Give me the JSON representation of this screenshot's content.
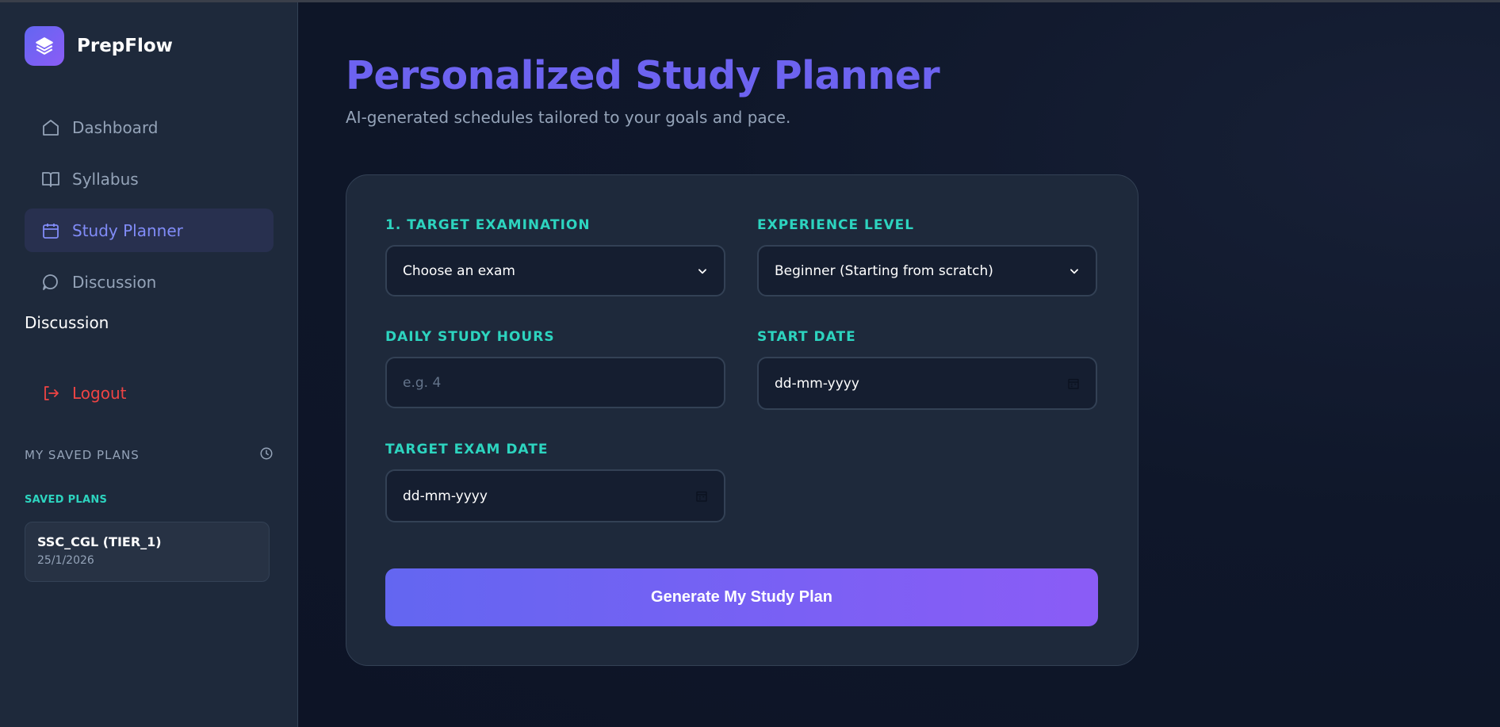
{
  "app": {
    "name": "PrepFlow"
  },
  "sidebar": {
    "items": [
      {
        "label": "Dashboard",
        "icon": "home-icon"
      },
      {
        "label": "Syllabus",
        "icon": "book-icon"
      },
      {
        "label": "Study Planner",
        "icon": "calendar-icon",
        "active": true
      },
      {
        "label": "Discussion",
        "icon": "chat-icon"
      }
    ],
    "extra_label": "Discussion",
    "logout_label": "Logout",
    "saved_header": "MY SAVED PLANS",
    "saved_subheader": "SAVED PLANS",
    "saved_plans": [
      {
        "title": "SSC_CGL (TIER_1)",
        "date": "25/1/2026"
      }
    ]
  },
  "main": {
    "title": "Personalized Study Planner",
    "subtitle": "AI-generated schedules tailored to your goals and pace.",
    "form": {
      "exam_label": "1. TARGET EXAMINATION",
      "exam_value": "Choose an exam",
      "level_label": "EXPERIENCE LEVEL",
      "level_value": "Beginner (Starting from scratch)",
      "hours_label": "DAILY STUDY HOURS",
      "hours_placeholder": "e.g. 4",
      "start_label": "START DATE",
      "start_value": "dd-mm-yyyy",
      "target_label": "TARGET EXAM DATE",
      "target_value": "dd-mm-yyyy",
      "submit_label": "Generate My Study Plan"
    }
  },
  "colors": {
    "accent": "#6366f1",
    "accent2": "#8b5cf6",
    "teal": "#2dd4bf",
    "danger": "#ef4444"
  }
}
